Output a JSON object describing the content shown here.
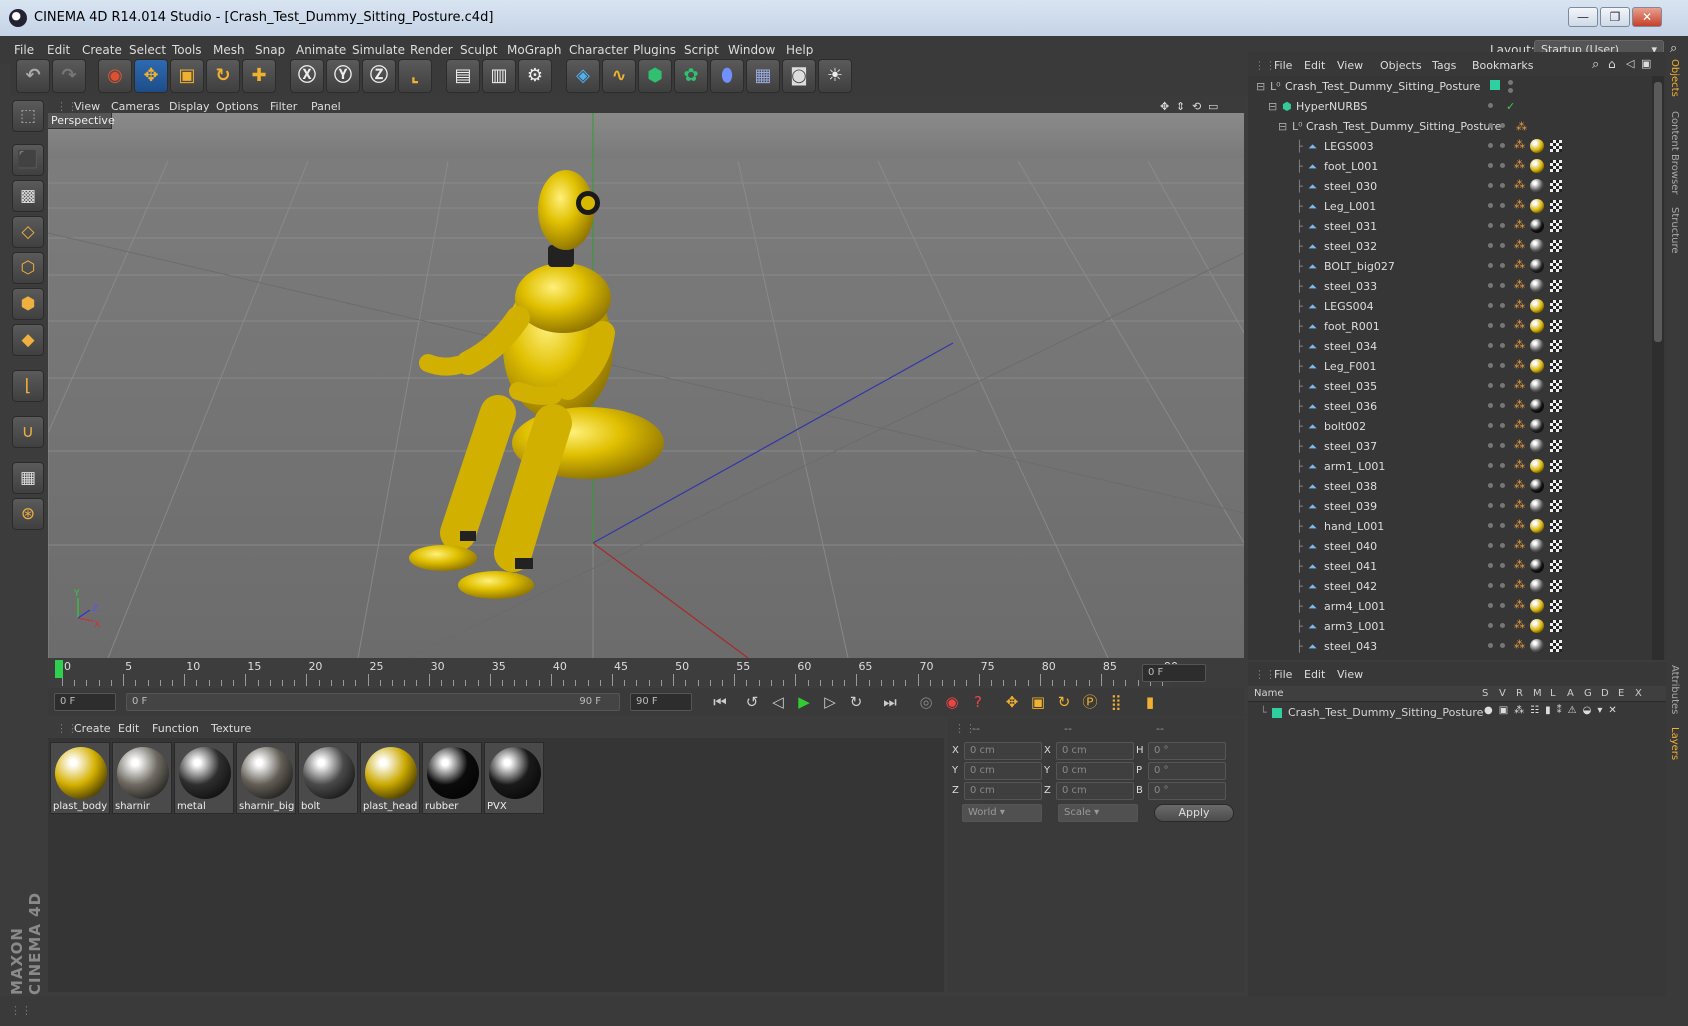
{
  "window": {
    "title": "CINEMA 4D R14.014 Studio - [Crash_Test_Dummy_Sitting_Posture.c4d]",
    "minimize": "—",
    "restore": "❐",
    "close": "✕"
  },
  "menu": [
    "File",
    "Edit",
    "Create",
    "Select",
    "Tools",
    "Mesh",
    "Snap",
    "Animate",
    "Simulate",
    "Render",
    "Sculpt",
    "MoGraph",
    "Character",
    "Plugins",
    "Script",
    "Window",
    "Help"
  ],
  "layout": {
    "label": "Layout:",
    "value": "Startup (User)"
  },
  "viewport": {
    "menu": [
      "View",
      "Cameras",
      "Display",
      "Options",
      "Filter",
      "Panel"
    ],
    "label": "Perspective"
  },
  "timeline": {
    "ticks": [
      "0",
      "5",
      "10",
      "15",
      "20",
      "25",
      "30",
      "35",
      "40",
      "45",
      "50",
      "55",
      "60",
      "65",
      "70",
      "75",
      "80",
      "85",
      "90"
    ],
    "frame_field": "0 F"
  },
  "transport": {
    "start_field": "0 F",
    "range_start": "0 F",
    "range_end": "90 F",
    "end_field": "90 F"
  },
  "materials": {
    "menu": [
      "Create",
      "Edit",
      "Function",
      "Texture"
    ],
    "items": [
      {
        "name": "plast_body",
        "color": "#d4b000"
      },
      {
        "name": "sharnir",
        "color": "#6e6a62"
      },
      {
        "name": "metal",
        "color": "#2e2e2e"
      },
      {
        "name": "sharnir_big",
        "color": "#625e56"
      },
      {
        "name": "bolt",
        "color": "#4a4a4a"
      },
      {
        "name": "plast_head",
        "color": "#c9a800"
      },
      {
        "name": "rubber",
        "color": "#0b0b0b"
      },
      {
        "name": "PVX",
        "color": "#1a1a1a"
      }
    ]
  },
  "coords": {
    "headers": [
      "--",
      "--",
      "--"
    ],
    "rows": [
      {
        "a": "X",
        "v1": "0 cm",
        "b": "X",
        "v2": "0 cm",
        "c": "H",
        "v3": "0 °"
      },
      {
        "a": "Y",
        "v1": "0 cm",
        "b": "Y",
        "v2": "0 cm",
        "c": "P",
        "v3": "0 °"
      },
      {
        "a": "Z",
        "v1": "0 cm",
        "b": "Z",
        "v2": "0 cm",
        "c": "B",
        "v3": "0 °"
      }
    ],
    "world": "World",
    "scale": "Scale",
    "apply": "Apply"
  },
  "objects": {
    "menu": [
      "File",
      "Edit",
      "View",
      "Objects",
      "Tags",
      "Bookmarks"
    ],
    "root": "Crash_Test_Dummy_Sitting_Posture",
    "hyper": "HyperNURBS",
    "group": "Crash_Test_Dummy_Sitting_Posture",
    "children": [
      {
        "name": "LEGS003",
        "tag": "#d4b000"
      },
      {
        "name": "foot_L001",
        "tag": "#d4b000"
      },
      {
        "name": "steel_030",
        "tag": "#555"
      },
      {
        "name": "Leg_L001",
        "tag": "#d4b000"
      },
      {
        "name": "steel_031",
        "tag": "#111"
      },
      {
        "name": "steel_032",
        "tag": "#555"
      },
      {
        "name": "BOLT_big027",
        "tag": "#222"
      },
      {
        "name": "steel_033",
        "tag": "#555"
      },
      {
        "name": "LEGS004",
        "tag": "#d4b000"
      },
      {
        "name": "foot_R001",
        "tag": "#d4b000"
      },
      {
        "name": "steel_034",
        "tag": "#555"
      },
      {
        "name": "Leg_F001",
        "tag": "#d4b000"
      },
      {
        "name": "steel_035",
        "tag": "#555"
      },
      {
        "name": "steel_036",
        "tag": "#111"
      },
      {
        "name": "bolt002",
        "tag": "#222"
      },
      {
        "name": "steel_037",
        "tag": "#555"
      },
      {
        "name": "arm1_L001",
        "tag": "#d4b000"
      },
      {
        "name": "steel_038",
        "tag": "#111"
      },
      {
        "name": "steel_039",
        "tag": "#555"
      },
      {
        "name": "hand_L001",
        "tag": "#d4b000"
      },
      {
        "name": "steel_040",
        "tag": "#555"
      },
      {
        "name": "steel_041",
        "tag": "#111"
      },
      {
        "name": "steel_042",
        "tag": "#555"
      },
      {
        "name": "arm4_L001",
        "tag": "#d4b000"
      },
      {
        "name": "arm3_L001",
        "tag": "#d4b000"
      },
      {
        "name": "steel_043",
        "tag": "#555"
      }
    ]
  },
  "layers": {
    "menu": [
      "File",
      "Edit",
      "View"
    ],
    "name_header": "Name",
    "cols": [
      "S",
      "V",
      "R",
      "M",
      "L",
      "A",
      "G",
      "D",
      "E",
      "X"
    ],
    "row": "Crash_Test_Dummy_Sitting_Posture"
  },
  "side_tabs": [
    "Objects",
    "Content Browser",
    "Structure",
    "Attributes",
    "Layers"
  ],
  "branding": "MAXON CINEMA 4D"
}
